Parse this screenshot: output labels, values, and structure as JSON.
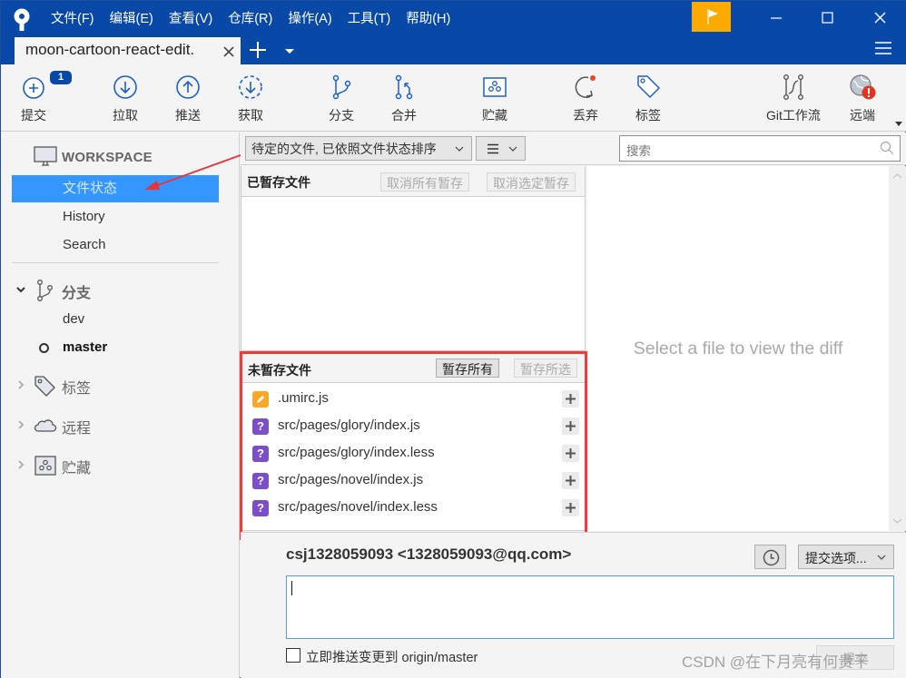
{
  "window": {
    "menu": [
      "文件(F)",
      "编辑(E)",
      "查看(V)",
      "仓库(R)",
      "操作(A)",
      "工具(T)",
      "帮助(H)"
    ],
    "tab_title": "moon-cartoon-react-edit.",
    "flag_color": "#fbab00",
    "title_bar_color": "#0849a8"
  },
  "toolbar": {
    "commit": {
      "label": "提交",
      "badge": "1"
    },
    "pull": {
      "label": "拉取"
    },
    "push": {
      "label": "推送"
    },
    "fetch": {
      "label": "获取"
    },
    "branch": {
      "label": "分支"
    },
    "merge": {
      "label": "合并"
    },
    "stash": {
      "label": "贮藏"
    },
    "discard": {
      "label": "丢弃"
    },
    "tag": {
      "label": "标签"
    },
    "gitflow": {
      "label": "Git工作流"
    },
    "remote": {
      "label": "远端"
    }
  },
  "sidebar": {
    "workspace_label": "WORKSPACE",
    "workspace_items": [
      {
        "label": "文件状态",
        "active": true
      },
      {
        "label": "History",
        "active": false
      },
      {
        "label": "Search",
        "active": false
      }
    ],
    "branches_label": "分支",
    "branches": [
      {
        "name": "dev",
        "current": false
      },
      {
        "name": "master",
        "current": true
      }
    ],
    "tags_label": "标签",
    "remotes_label": "远程",
    "stashes_label": "贮藏",
    "active_color": "#3496ff"
  },
  "filter": {
    "sort_select": "待定的文件, 已依照文件状态排序",
    "view_select_icon": "list-icon",
    "search_placeholder": "搜索"
  },
  "staged": {
    "title": "已暂存文件",
    "unstage_all": "取消所有暂存",
    "unstage_selected": "取消选定暂存",
    "files": []
  },
  "unstaged": {
    "title": "未暂存文件",
    "stage_all": "暂存所有",
    "stage_selected": "暂存所选",
    "highlight_color": "#f23a3a",
    "files": [
      {
        "name": ".umirc.js",
        "status": "modified",
        "status_icon": "pencil-icon",
        "color": "#f9a825"
      },
      {
        "name": "src/pages/glory/index.js",
        "status": "untracked",
        "status_icon": "question-icon",
        "color": "#7a4fc9"
      },
      {
        "name": "src/pages/glory/index.less",
        "status": "untracked",
        "status_icon": "question-icon",
        "color": "#7a4fc9"
      },
      {
        "name": "src/pages/novel/index.js",
        "status": "untracked",
        "status_icon": "question-icon",
        "color": "#7a4fc9"
      },
      {
        "name": "src/pages/novel/index.less",
        "status": "untracked",
        "status_icon": "question-icon",
        "color": "#7a4fc9"
      }
    ]
  },
  "diff": {
    "placeholder": "Select a file to view the diff"
  },
  "commit": {
    "author": "csj1328059093 <1328059093@qq.com>",
    "options_label": "提交选项...",
    "message_value": "",
    "push_checkbox_label": "立即推送变更到 origin/master",
    "push_checked": false,
    "commit_button": "提交"
  },
  "watermark": "CSDN @在下月亮有何贵干"
}
